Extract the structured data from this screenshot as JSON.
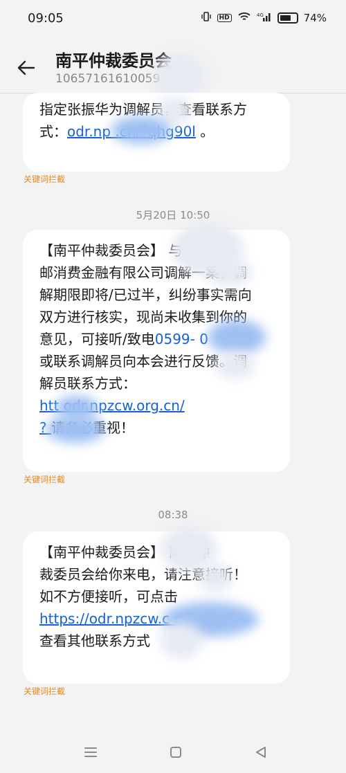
{
  "status_bar": {
    "time": "09:05",
    "hd_badge": "HD",
    "network": "4G",
    "battery": "74%"
  },
  "header": {
    "title": "南平仲裁委员会",
    "number": "10657161610059"
  },
  "messages": [
    {
      "lines": [
        "指定张振华为调解员，查看联系方",
        "式：odr.np          .cn/?qhg90l 。"
      ],
      "link_text": "odr.np          .cn/?qhg90l",
      "tag": "关键词拦截"
    },
    {
      "timestamp": "5月20日 10:50",
      "lines": [
        "【南平仲裁委员会】      与中",
        "邮消费金融有限公司调解一案，调",
        "解期限即将/已过半，纠纷事实需向",
        "双方进行核实，现尚未收集到你的",
        "意见，可接听/致电0599-      0",
        "或联系调解员向本会进行反馈。调",
        "解员联系方式：",
        "htt     odr.npzcw.org.cn/",
        "?         请务必重视！"
      ],
      "tag": "关键词拦截"
    },
    {
      "timestamp": "08:38",
      "lines": [
        "【南平仲裁委员会】        南平仲",
        "裁委员会给你来电，请注意接听！",
        "如不方便接听，可点击",
        "https://odr.npzcw.c          d",
        "查看其他联系方式"
      ],
      "tag": "关键词拦截"
    }
  ],
  "nav": {
    "menu_icon": "menu-icon",
    "home_icon": "home-icon",
    "back_icon": "back-triangle-icon"
  },
  "colors": {
    "link": "#1560d6",
    "tag": "#e08a25",
    "background": "#f3f3f3"
  }
}
